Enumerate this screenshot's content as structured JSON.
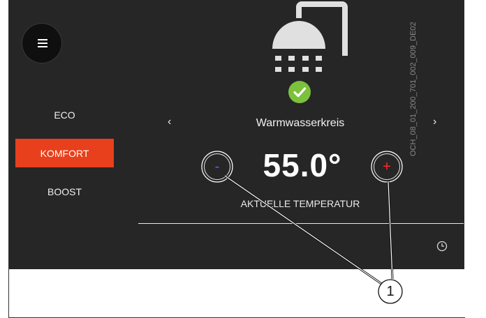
{
  "menu": {
    "icon": "hamburger-menu-icon"
  },
  "modes": [
    {
      "label": "ECO",
      "active": false
    },
    {
      "label": "KOMFORT",
      "active": true
    },
    {
      "label": "BOOST",
      "active": false
    }
  ],
  "header": {
    "icon": "shower-icon",
    "status_icon": "checkmark-icon",
    "status_color": "#7cc13b",
    "prev_arrow": "‹",
    "next_arrow": "›",
    "circuit_label": "Warmwasserkreis"
  },
  "temperature": {
    "minus_label": "-",
    "plus_label": "+",
    "value": "55.0°",
    "label": "AKTUELLE TEMPERATUR"
  },
  "footer": {
    "timer_icon": "timer-icon"
  },
  "annotation": {
    "callout_number": "1",
    "doc_code": "OCH_08_01_200_701_002_009_DE02"
  },
  "colors": {
    "panel_bg": "#262626",
    "accent": "#e8401c",
    "minus": "#5b5bff",
    "plus": "#ff2b2b"
  }
}
